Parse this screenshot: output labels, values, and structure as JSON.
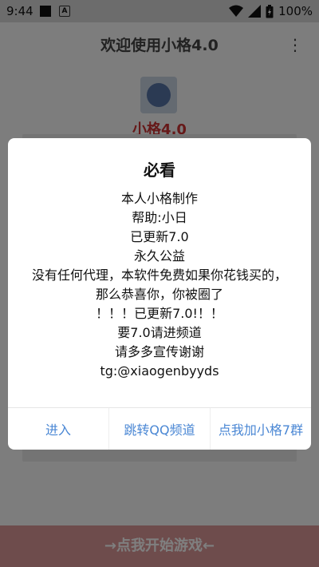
{
  "status_bar": {
    "time": "9:44",
    "battery_percent": "100%"
  },
  "app": {
    "title": "欢迎使用小格4.0",
    "subtitle": "小格4.0",
    "start_button": "→点我开始游戏←"
  },
  "dialog": {
    "title": "必看",
    "lines": [
      "本人小格制作",
      "帮助:小日",
      "已更新7.0",
      "永久公益",
      "没有任何代理，本软件免费如果你花钱买的，那么恭喜你，你被圈了",
      "！！！已更新7.0!！！",
      "要7.0请进频道",
      "请多多宣传谢谢",
      "tg:@xiaogenbyyds"
    ],
    "buttons": {
      "enter": "进入",
      "qq_channel": "跳转QQ频道",
      "add_author": "点我加小格7群"
    }
  },
  "colors": {
    "accent": "#4a87d4",
    "scrim": "rgba(0,0,0,0.5)"
  }
}
